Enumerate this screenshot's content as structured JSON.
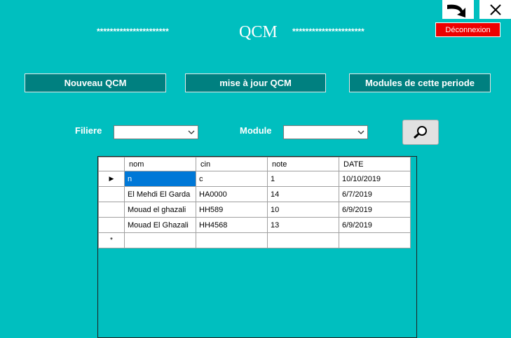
{
  "window": {
    "title": "QCM",
    "stars_left": "**********************",
    "stars_right": "**********************",
    "logout_label": "Déconnexion"
  },
  "icons": {
    "back": "arrow-curved-down-icon",
    "close": "close-icon",
    "search": "magnifier-icon"
  },
  "toolbar": {
    "new_qcm": "Nouveau QCM",
    "update_qcm": "mise à jour QCM",
    "modules_period": "Modules de cette periode"
  },
  "filters": {
    "filiere_label": "Filiere",
    "filiere_value": "",
    "module_label": "Module",
    "module_value": ""
  },
  "grid": {
    "columns": [
      "nom",
      "cin",
      "note",
      "DATE"
    ],
    "rows": [
      {
        "nom": "n",
        "cin": "c",
        "note": "1",
        "date": "10/10/2019"
      },
      {
        "nom": "El Mehdi El Garda",
        "cin": "HA0000",
        "note": "14",
        "date": "6/7/2019"
      },
      {
        "nom": "Mouad el ghazali",
        "cin": "HH589",
        "note": "10",
        "date": "6/9/2019"
      },
      {
        "nom": "Mouad El Ghazali",
        "cin": "HH4568",
        "note": "13",
        "date": "6/9/2019"
      }
    ],
    "current_row_marker": "▶",
    "new_row_marker": "*"
  },
  "colors": {
    "background": "#00BFBF",
    "button": "#008080",
    "logout": "#ee0000",
    "selection": "#0078d7"
  }
}
